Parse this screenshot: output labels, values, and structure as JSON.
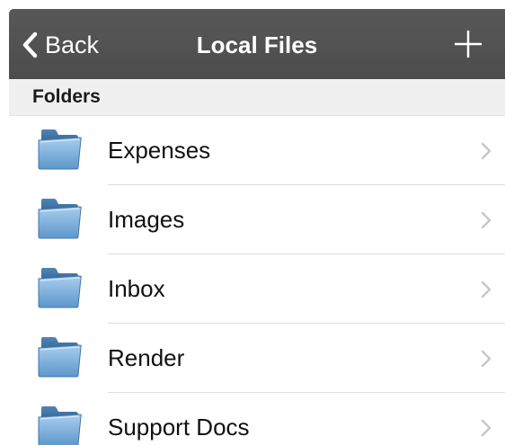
{
  "navbar": {
    "back_label": "Back",
    "title": "Local Files",
    "back_icon": "chevron-left-icon",
    "add_icon": "plus-icon"
  },
  "section": {
    "title": "Folders"
  },
  "folders": [
    {
      "label": "Expenses"
    },
    {
      "label": "Images"
    },
    {
      "label": "Inbox"
    },
    {
      "label": "Render"
    },
    {
      "label": "Support Docs"
    }
  ],
  "colors": {
    "navbar_bg": "#505050",
    "section_bg": "#f0f0f0",
    "folder_blue": "#6aa6d6",
    "chevron": "#c7c7cc"
  }
}
